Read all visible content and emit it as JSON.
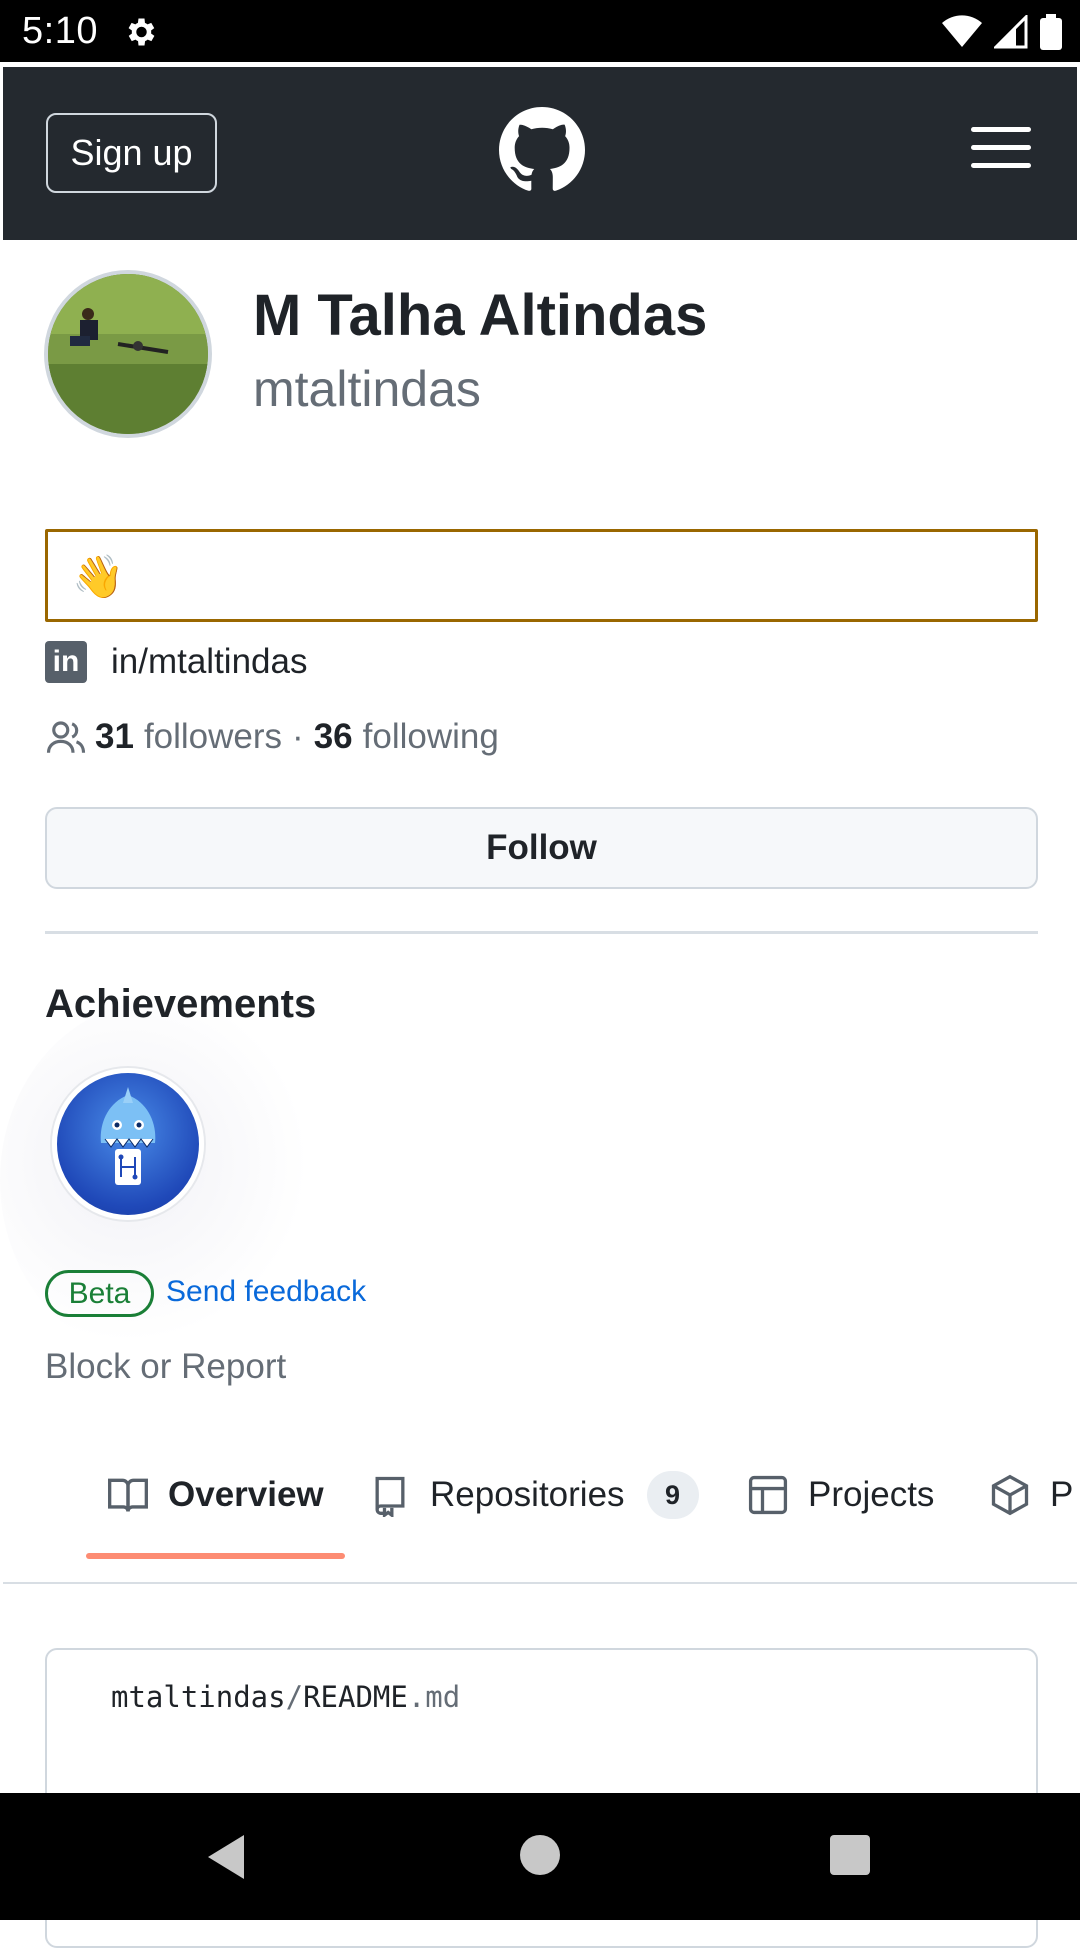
{
  "status_bar": {
    "time": "5:10",
    "icons": [
      "settings-gear-icon",
      "wifi-icon",
      "signal-icon",
      "battery-icon"
    ]
  },
  "header": {
    "signup_label": "Sign up",
    "logo": "github-logo-icon",
    "menu": "hamburger-menu-icon",
    "background_color": "#24292f"
  },
  "profile": {
    "full_name": "M Talha Altindas",
    "username": "mtaltindas",
    "status_emoji": "👋",
    "linkedin_text": "in/mtaltindas",
    "followers_count": "31",
    "followers_label": "followers",
    "separator": "·",
    "following_count": "36",
    "following_label": "following",
    "follow_label": "Follow"
  },
  "achievements": {
    "title": "Achievements",
    "badge": "shark-achievement-badge",
    "beta_label": "Beta",
    "feedback_label": "Send feedback"
  },
  "block_report_label": "Block or Report",
  "tabs": [
    {
      "label": "Overview",
      "icon": "book-icon",
      "active": true
    },
    {
      "label": "Repositories",
      "icon": "repo-icon",
      "count": "9"
    },
    {
      "label": "Projects",
      "icon": "table-icon"
    },
    {
      "label": "P",
      "icon": "package-icon"
    }
  ],
  "readme": {
    "owner": "mtaltindas",
    "separator": "/",
    "file_name": "README",
    "file_ext": ".md"
  },
  "colors": {
    "accent_underline": "#fd8c73",
    "link": "#0969da",
    "beta_green": "#1a7f37",
    "status_border": "#9a6700"
  }
}
